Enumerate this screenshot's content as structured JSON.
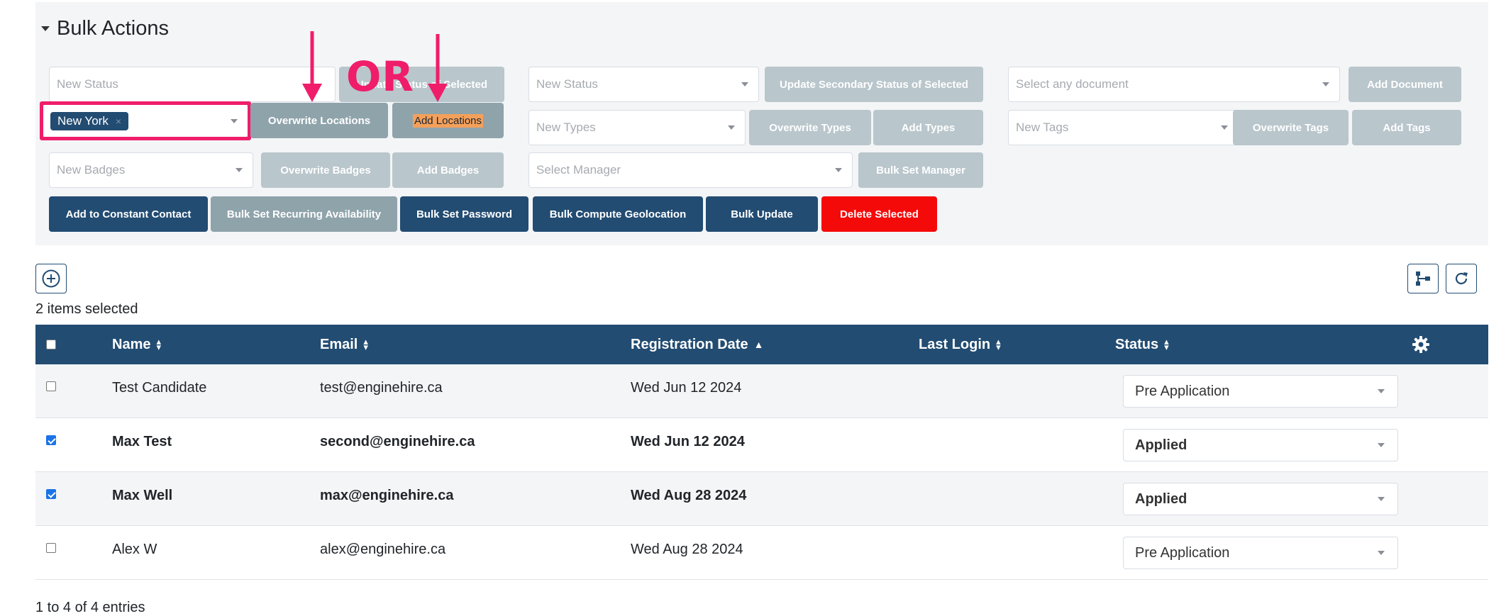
{
  "bulk": {
    "title": "Bulk Actions",
    "row1": {
      "status_placeholder": "New Status",
      "update_status_btn": "Update Status of Selected",
      "secondary_status_placeholder": "New Status",
      "update_secondary_btn": "Update Secondary Status of Selected",
      "document_placeholder": "Select any document",
      "add_document_btn": "Add Document"
    },
    "row2": {
      "location_tag": "New York",
      "location_tag_remove": "×",
      "overwrite_locations_btn": "Overwrite Locations",
      "add_locations_btn": "Add Locations",
      "types_placeholder": "New Types",
      "overwrite_types_btn": "Overwrite Types",
      "add_types_btn": "Add Types",
      "tags_placeholder": "New Tags",
      "overwrite_tags_btn": "Overwrite Tags",
      "add_tags_btn": "Add Tags"
    },
    "row3": {
      "badges_placeholder": "New Badges",
      "overwrite_badges_btn": "Overwrite Badges",
      "add_badges_btn": "Add Badges",
      "manager_placeholder": "Select Manager",
      "bulk_set_manager_btn": "Bulk Set Manager"
    },
    "row4": {
      "constant_contact_btn": "Add to Constant Contact",
      "recurring_btn": "Bulk Set Recurring Availability",
      "password_btn": "Bulk Set Password",
      "geolocation_btn": "Bulk Compute Geolocation",
      "bulk_update_btn": "Bulk Update",
      "delete_btn": "Delete Selected"
    },
    "annotation_or": "OR"
  },
  "table": {
    "items_selected": "2 items selected",
    "headers": {
      "name": "Name",
      "email": "Email",
      "registration_date": "Registration Date",
      "last_login": "Last Login",
      "status": "Status"
    },
    "rows": [
      {
        "name": "Test Candidate",
        "email": "test@enginehire.ca",
        "registration_date": "Wed Jun 12 2024",
        "last_login": "",
        "status": "Pre Application",
        "checked": false
      },
      {
        "name": "Max Test",
        "email": "second@enginehire.ca",
        "registration_date": "Wed Jun 12 2024",
        "last_login": "",
        "status": "Applied",
        "checked": true
      },
      {
        "name": "Max Well",
        "email": "max@enginehire.ca",
        "registration_date": "Wed Aug 28 2024",
        "last_login": "",
        "status": "Applied",
        "checked": true
      },
      {
        "name": "Alex W",
        "email": "alex@enginehire.ca",
        "registration_date": "Wed Aug 28 2024",
        "last_login": "",
        "status": "Pre Application",
        "checked": false
      }
    ],
    "footer": "1 to 4 of 4 entries"
  },
  "colors": {
    "primary": "#224c72",
    "danger": "#f50a0a",
    "annotation": "#ef1d6a",
    "muted_button": "#b9c6cc"
  }
}
